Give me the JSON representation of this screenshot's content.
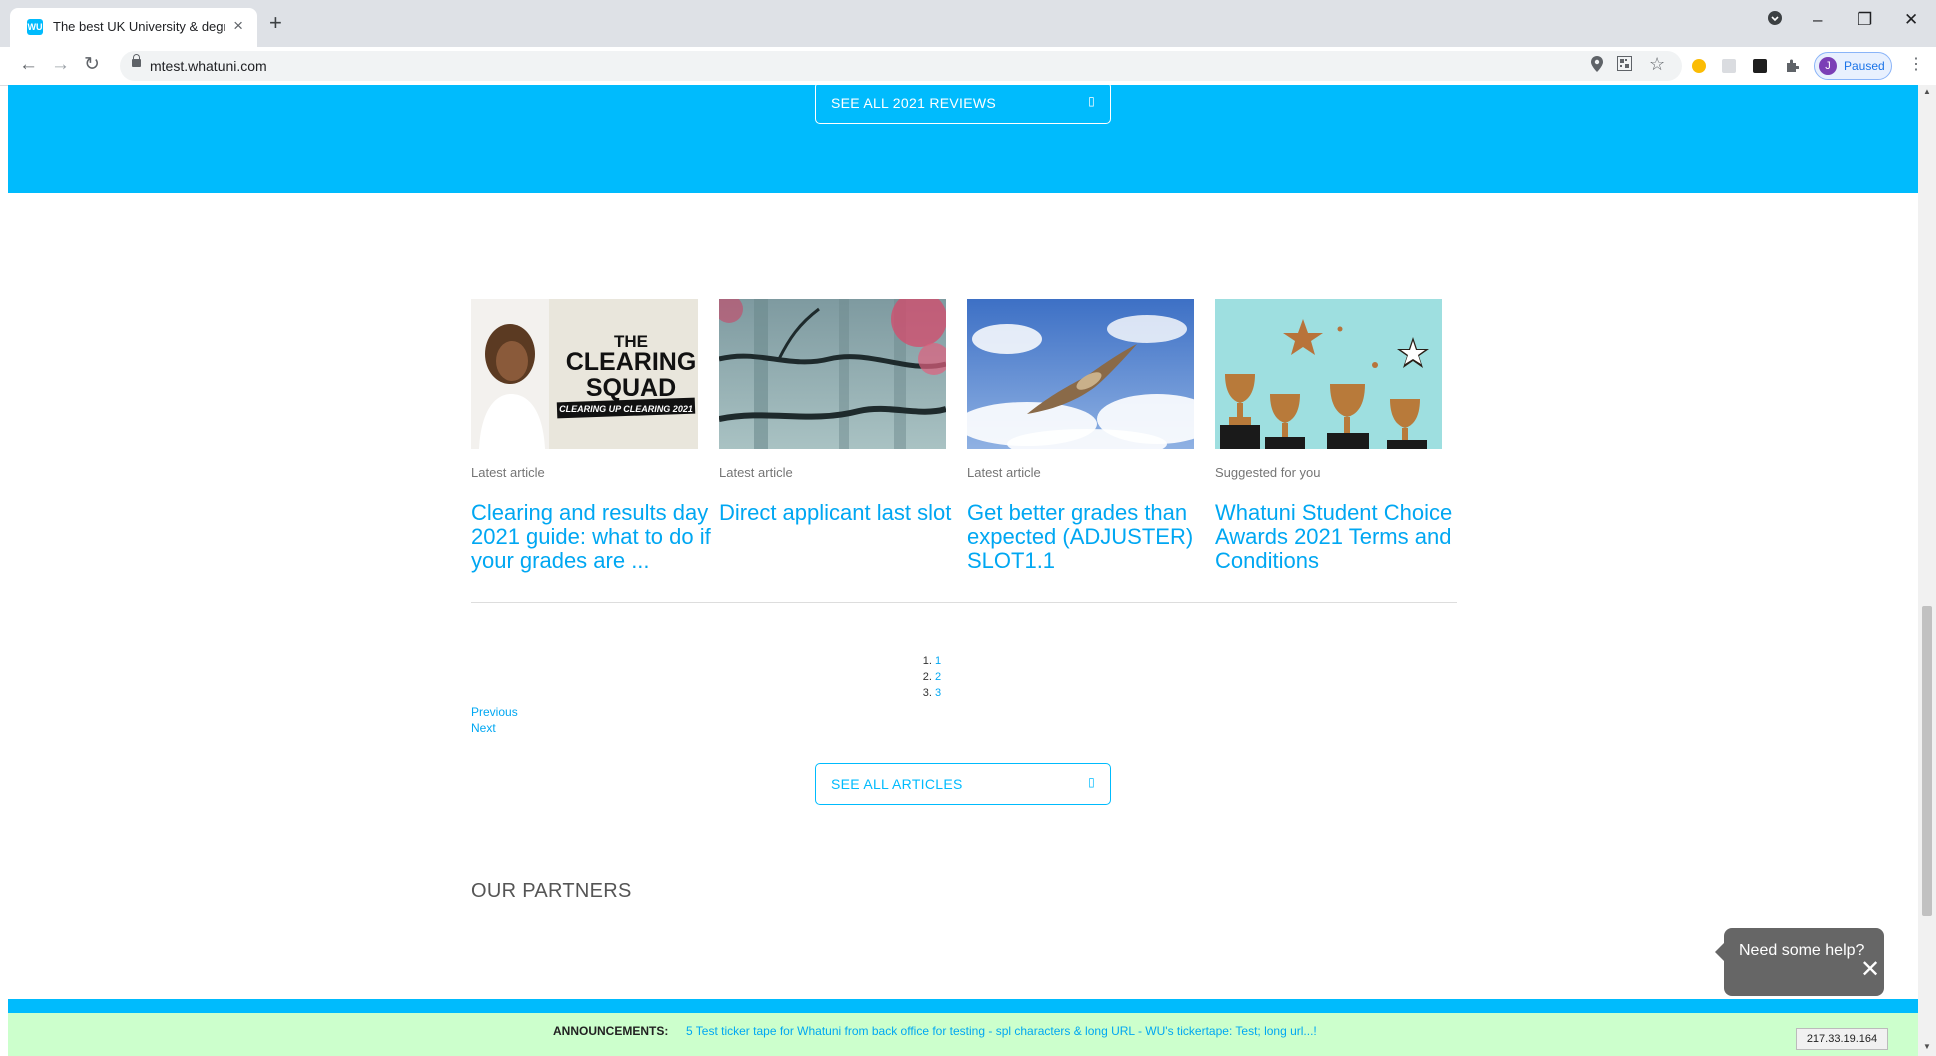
{
  "browser": {
    "tab_title": "The best UK University & degree",
    "favicon_text": "WU",
    "tab_close": "×",
    "new_tab": "+",
    "url": "mtest.whatuni.com",
    "profile_initial": "J",
    "profile_status": "Paused",
    "window": {
      "minimize": "–",
      "restore": "❐",
      "close": "✕"
    },
    "nav": {
      "back": "←",
      "forward": "→",
      "reload": "↻"
    },
    "icons": {
      "location": "location-pin-icon",
      "translate": "qr-code-icon",
      "bookmark": "star-icon",
      "menu": "⋮"
    }
  },
  "reviews_button": {
    "label": "SEE ALL 2021 REVIEWS",
    "arrow_icon": "arrow-box-icon"
  },
  "articles": [
    {
      "category": "Latest article",
      "title": "Clearing and results day 2021 guide: what to do if your grades are ...",
      "image_text": [
        "THE",
        "CLEARING",
        "SQUAD",
        "CLEARING UP CLEARING 2021"
      ]
    },
    {
      "category": "Latest article",
      "title": "Direct applicant last slot"
    },
    {
      "category": "Latest article",
      "title": "Get better grades than expected (ADJUSTER) SLOT1.1"
    },
    {
      "category": "Suggested for you",
      "title": "Whatuni Student Choice Awards 2021 Terms and Conditions"
    }
  ],
  "pagination": {
    "pages": [
      "1",
      "2",
      "3"
    ],
    "previous": "Previous",
    "next": "Next"
  },
  "articles_button": {
    "label": "SEE ALL ARTICLES",
    "arrow_icon": "arrow-box-icon"
  },
  "partners_heading": "OUR PARTNERS",
  "help_widget": {
    "label": "Need some help?",
    "close": "✕"
  },
  "ticker": {
    "label": "ANNOUNCEMENTS:",
    "text": "5 Test ticker tape for Whatuni from back office for testing - spl characters & long URL - WU's tickertape: Test; long url...!"
  },
  "ip_badge": "217.33.19.164",
  "colors": {
    "brand_blue": "#00bbfd",
    "link_blue": "#00a7f2",
    "ticker_bg": "#ccffcc"
  }
}
